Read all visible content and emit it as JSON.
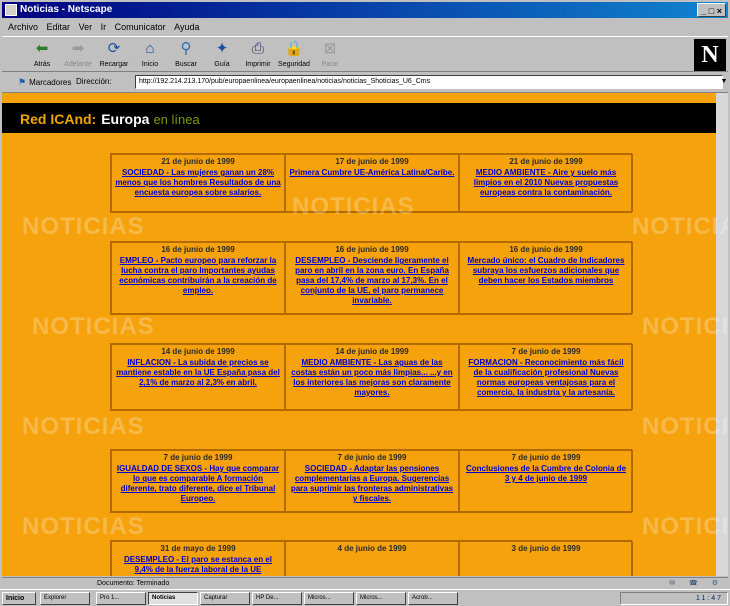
{
  "window": {
    "title": "Noticias - Netscape",
    "controls": "_ □ ×"
  },
  "menu": [
    "Archivo",
    "Editar",
    "Ver",
    "Ir",
    "Comunicator",
    "Ayuda"
  ],
  "toolbar": [
    {
      "label": "Atrás",
      "icon": "back-arrow-icon",
      "glyph": "⬅",
      "color": "#2d7d2d",
      "enabled": true
    },
    {
      "label": "Adelante",
      "icon": "forward-arrow-icon",
      "glyph": "➡",
      "color": "#2d7d2d",
      "enabled": false
    },
    {
      "label": "Recargar",
      "icon": "reload-icon",
      "glyph": "⟳",
      "color": "#1a4fa0",
      "enabled": true
    },
    {
      "label": "Inicio",
      "icon": "home-icon",
      "glyph": "⌂",
      "color": "#1a4fa0",
      "enabled": true
    },
    {
      "label": "Buscar",
      "icon": "search-icon",
      "glyph": "⚲",
      "color": "#2d6db0",
      "enabled": true
    },
    {
      "label": "Guía",
      "icon": "guide-icon",
      "glyph": "✦",
      "color": "#1a4fa0",
      "enabled": true
    },
    {
      "label": "Imprimir",
      "icon": "print-icon",
      "glyph": "⎙",
      "color": "#3a3a7a",
      "enabled": true
    },
    {
      "label": "Seguridad",
      "icon": "security-lock-icon",
      "glyph": "🔒",
      "color": "#8a2020",
      "enabled": true
    },
    {
      "label": "Parar",
      "icon": "stop-icon",
      "glyph": "⊠",
      "color": "#888888",
      "enabled": false
    }
  ],
  "location": {
    "bookmarks_label": "Marcadores",
    "location_label": "Dirección:",
    "url": "http://192.214.213.170/pub/europaenlinea/europaenlinea/noticias/noticias_Shoticias_U6_Cms"
  },
  "site": {
    "title_red": "Red ICAnd:",
    "title_white": "Europa",
    "title_green": "en línea"
  },
  "watermark": "NOTICIAS",
  "news_blocks": [
    [
      {
        "date": "21 de junio de 1999",
        "text": "SOCIEDAD - Las mujeres ganan un 28% menos que los hombres Resultados de una encuesta europea sobre salarios."
      },
      {
        "date": "17 de junio de 1999",
        "text": "Primera Cumbre UE-América Latina/Caribe."
      },
      {
        "date": "21 de junio de 1999",
        "text": "MEDIO AMBIENTE - Aire y suelo más limpios en el 2010 Nuevas propuestas europeas contra la contaminación."
      }
    ],
    [
      {
        "date": "16 de junio de 1999",
        "text": "EMPLEO - Pacto europeo para reforzar la lucha contra el paro Importantes ayudas económicas contribuirán a la creación de empleo."
      },
      {
        "date": "16 de junio de 1999",
        "text": "DESEMPLEO - Desciende ligeramente el paro en abril en la zona euro. En España pasa del 17,4% de marzo al 17,3%. En el conjunto de la UE, el paro permanece invariable."
      },
      {
        "date": "16 de junio de 1999",
        "text": "Mercado único: el Cuadro de Indicadores subraya los esfuerzos adicionales que deben hacer los Estados miembros"
      }
    ],
    [
      {
        "date": "14 de junio de 1999",
        "text": "INFLACION - La subida de precios se mantiene estable en la UE España pasa del 2,1% de marzo al 2,3% en abril."
      },
      {
        "date": "14 de junio de 1999",
        "text": "MEDIO AMBIENTE - Las aguas de las costas están un poco más limpias... ...y en los interiores las mejoras son claramente mayores."
      },
      {
        "date": "7 de junio de 1999",
        "text": "FORMACION - Reconocimiento más fácil de la cualificación profesional Nuevas normas europeas ventajosas para el comercio, la industria y la artesanía."
      }
    ],
    [
      {
        "date": "7 de junio de 1999",
        "text": "IGUALDAD DE SEXOS - Hay que comparar lo que es comparable A formación diferente, trato diferente, dice el Tribunal Europeo."
      },
      {
        "date": "7 de junio de 1999",
        "text": "SOCIEDAD - Adaptar las pensiones complementarias a Europa. Sugerencias para suprimir las fronteras administrativas y fiscales."
      },
      {
        "date": "7 de junio de 1999",
        "text": "Conclusiones de la Cumbre de Colonia de 3 y 4 de junio de 1999"
      }
    ],
    [
      {
        "date": "31 de mayo de 1999",
        "text": "DESEMPLEO - El paro se estanca en el 9,4% de la fuerza laboral de la UE"
      },
      {
        "date": "4 de junio de 1999",
        "text": ""
      },
      {
        "date": "3 de junio de 1999",
        "text": ""
      }
    ]
  ],
  "status": {
    "text": "Documento: Terminado"
  },
  "taskbar": {
    "start": "Inicio",
    "tasks": [
      "Explorer",
      "Pro 1...",
      "Noticias",
      "Capturar",
      "HP De...",
      "Micros...",
      "Micros...",
      "Acrob..."
    ],
    "tray_time": "11:47"
  }
}
